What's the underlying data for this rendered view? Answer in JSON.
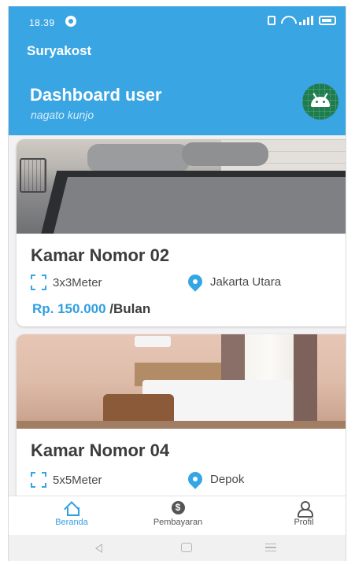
{
  "status": {
    "time": "18.39"
  },
  "header": {
    "app_title": "Suryakost",
    "dashboard_title": "Dashboard user",
    "username": "nagato kunjo"
  },
  "rooms": [
    {
      "name": "Kamar Nomor 02",
      "size": "3x3Meter",
      "location": "Jakarta Utara",
      "price": "Rp. 150.000",
      "period": "/Bulan"
    },
    {
      "name": "Kamar Nomor 04",
      "size": "5x5Meter",
      "location": "Depok"
    }
  ],
  "bottom_nav": {
    "items": [
      {
        "label": "Beranda",
        "icon": "home-icon",
        "active": true
      },
      {
        "label": "Pembayaran",
        "icon": "dollar-icon",
        "active": false
      },
      {
        "label": "Profil",
        "icon": "user-icon",
        "active": false
      }
    ]
  },
  "colors": {
    "primary": "#3aa5e3",
    "accent_text": "#2f9fe0",
    "avatar": "#1e7d4e"
  }
}
